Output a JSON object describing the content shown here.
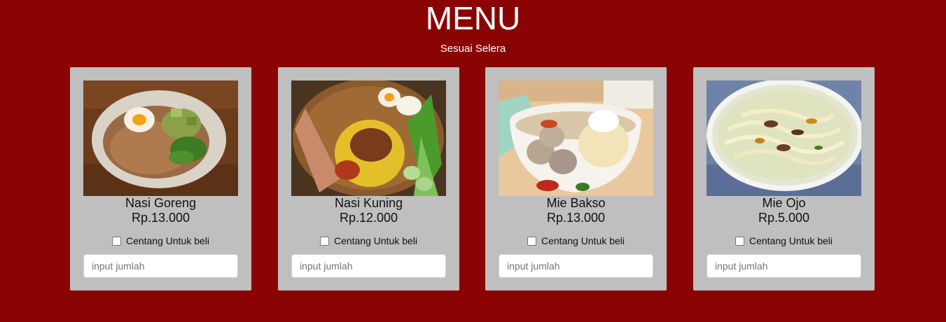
{
  "header": {
    "title": "MENU",
    "subtitle": "Sesuai Selera"
  },
  "menu": [
    {
      "name": "Nasi Goreng",
      "price": "Rp.13.000",
      "checkbox_label": "Centang Untuk beli",
      "checked": false,
      "quantity_placeholder": "input jumlah",
      "quantity_value": "",
      "image_icon": "fried-rice-photo"
    },
    {
      "name": "Nasi Kuning",
      "price": "Rp.12.000",
      "checkbox_label": "Centang Untuk beli",
      "checked": false,
      "quantity_placeholder": "input jumlah",
      "quantity_value": "",
      "image_icon": "yellow-rice-photo"
    },
    {
      "name": "Mie Bakso",
      "price": "Rp.13.000",
      "checkbox_label": "Centang Untuk beli",
      "checked": false,
      "quantity_placeholder": "input jumlah",
      "quantity_value": "",
      "image_icon": "meatball-noodle-photo"
    },
    {
      "name": "Mie Ojo",
      "price": "Rp.5.000",
      "checkbox_label": "Centang Untuk beli",
      "checked": false,
      "quantity_placeholder": "input jumlah",
      "quantity_value": "",
      "image_icon": "noodle-soup-photo"
    }
  ],
  "colors": {
    "background": "#8a0404",
    "card": "#bfbfbf",
    "text": "#111111",
    "heading": "#ffffff"
  }
}
